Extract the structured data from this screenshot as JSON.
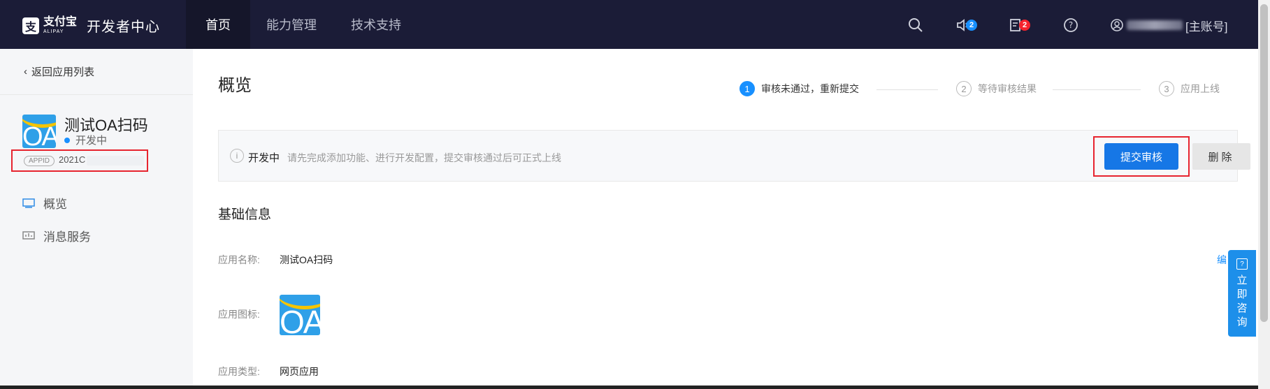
{
  "topbar": {
    "logo_cn": "支付宝",
    "logo_en": "ALIPAY",
    "title": "开发者中心",
    "nav": [
      "首页",
      "能力管理",
      "技术支持"
    ],
    "notifications_count": "2",
    "tasks_count": "2",
    "account_suffix": "[主账号]"
  },
  "sidebar": {
    "back_label": "返回应用列表",
    "app_name": "测试OA扫码",
    "app_status": "开发中",
    "appid_tag": "APPID",
    "appid_value": "2021C",
    "menu": [
      "概览",
      "消息服务"
    ]
  },
  "main": {
    "page_title": "概览",
    "steps": [
      {
        "num": "1",
        "label": "审核未通过，重新提交"
      },
      {
        "num": "2",
        "label": "等待审核结果"
      },
      {
        "num": "3",
        "label": "应用上线"
      }
    ],
    "notice_status": "开发中",
    "notice_text": "请先完成添加功能、进行开发配置，提交审核通过后可正式上线",
    "submit_label": "提交审核",
    "delete_label": "删除",
    "section_title": "基础信息",
    "edit_label": "编",
    "info": {
      "name_label": "应用名称:",
      "name_value": "测试OA扫码",
      "icon_label": "应用图标:",
      "type_label": "应用类型:",
      "type_value": "网页应用"
    }
  },
  "consult": {
    "label": "立即咨询"
  }
}
